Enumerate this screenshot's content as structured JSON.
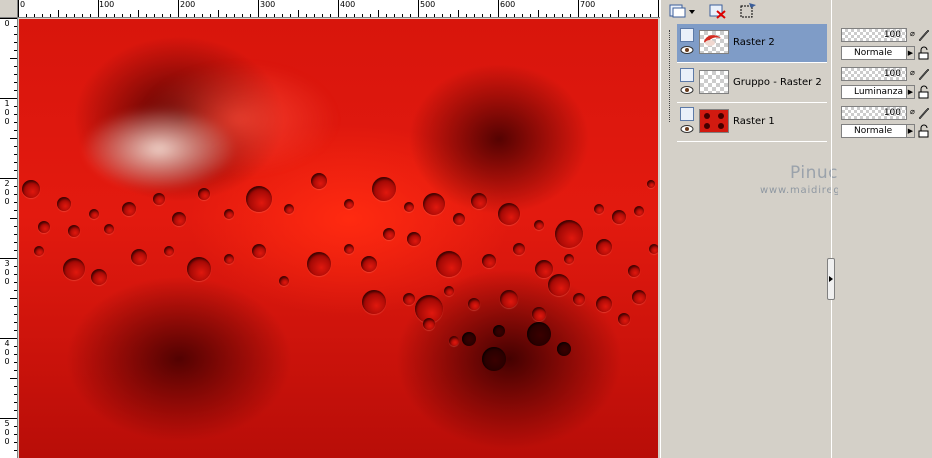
{
  "ruler": {
    "top_labels": [
      "0",
      "100",
      "200",
      "300",
      "400",
      "500",
      "600",
      "700"
    ],
    "left_labels": [
      [
        "0"
      ],
      [
        "1",
        "0",
        "0"
      ],
      [
        "2",
        "0",
        "0"
      ],
      [
        "3",
        "0",
        "0"
      ],
      [
        "4",
        "0",
        "0"
      ],
      [
        "5",
        "0",
        "0"
      ]
    ]
  },
  "toolbar": {
    "new_layer_icon": "new-layer-icon",
    "delete_layer_icon": "delete-layer-icon",
    "mask_icon": "selection-mask-icon"
  },
  "layers": [
    {
      "name": "Raster 2",
      "selected": true,
      "opacity": "100",
      "blend": "Normale",
      "thumb": "raster2"
    },
    {
      "name": "Gruppo - Raster 2",
      "selected": false,
      "opacity": "100",
      "blend": "Luminanza",
      "thumb": "empty"
    },
    {
      "name": "Raster 1",
      "selected": false,
      "opacity": "100",
      "blend": "Normale",
      "thumb": "raster1"
    }
  ],
  "watermark": {
    "title": "Pinuccia",
    "url": "www.maidiregrafica.eu"
  },
  "colors": {
    "selected_row": "#7f9cc7",
    "panel_bg": "#d4d0c8",
    "canvas_red": "#e31a0f"
  }
}
